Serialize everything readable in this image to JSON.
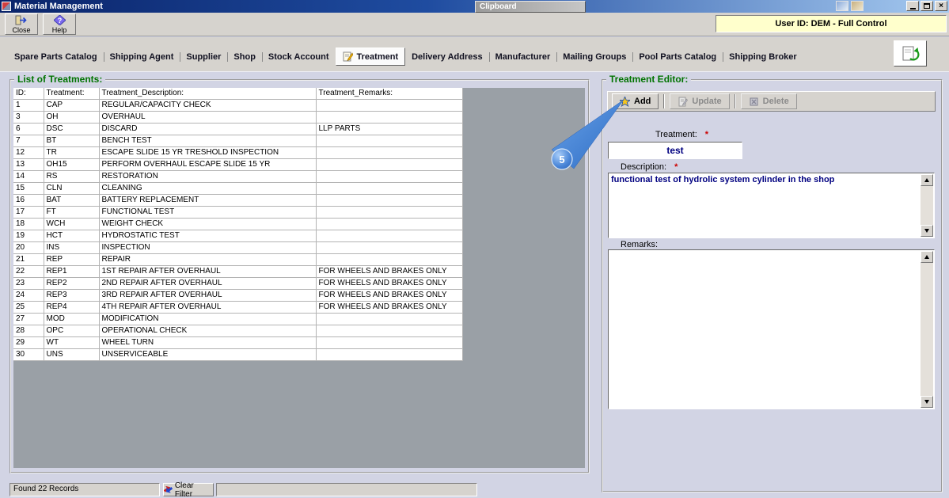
{
  "window": {
    "title": "Material Management",
    "clipboard_label": "Clipboard",
    "user_id": "User ID: DEM - Full Control",
    "controls": {
      "close_glyph": "×"
    }
  },
  "toolbar": {
    "close_label": "Close",
    "help_label": "Help"
  },
  "tabs": [
    {
      "label": "Spare Parts Catalog",
      "active": false
    },
    {
      "label": "Shipping Agent",
      "active": false
    },
    {
      "label": "Supplier",
      "active": false
    },
    {
      "label": "Shop",
      "active": false
    },
    {
      "label": "Stock Account",
      "active": false
    },
    {
      "label": "Treatment",
      "active": true
    },
    {
      "label": "Delivery Address",
      "active": false
    },
    {
      "label": "Manufacturer",
      "active": false
    },
    {
      "label": "Mailing Groups",
      "active": false
    },
    {
      "label": "Pool Parts Catalog",
      "active": false
    },
    {
      "label": "Shipping Broker",
      "active": false
    }
  ],
  "treatments": {
    "section_title": "List of Treatments:",
    "columns": [
      "ID:",
      "Treatment:",
      "Treatment_Description:",
      "Treatment_Remarks:"
    ],
    "rows": [
      [
        "1",
        "CAP",
        "REGULAR/CAPACITY CHECK",
        ""
      ],
      [
        "3",
        "OH",
        "OVERHAUL",
        ""
      ],
      [
        "6",
        "DSC",
        "DISCARD",
        "LLP PARTS"
      ],
      [
        "7",
        "BT",
        "BENCH TEST",
        ""
      ],
      [
        "12",
        "TR",
        "ESCAPE SLIDE 15 YR TRESHOLD INSPECTION",
        ""
      ],
      [
        "13",
        "OH15",
        "PERFORM OVERHAUL ESCAPE SLIDE 15 YR",
        ""
      ],
      [
        "14",
        "RS",
        "RESTORATION",
        ""
      ],
      [
        "15",
        "CLN",
        "CLEANING",
        ""
      ],
      [
        "16",
        "BAT",
        "BATTERY REPLACEMENT",
        ""
      ],
      [
        "17",
        "FT",
        "FUNCTIONAL TEST",
        ""
      ],
      [
        "18",
        "WCH",
        "WEIGHT CHECK",
        ""
      ],
      [
        "19",
        "HCT",
        "HYDROSTATIC TEST",
        ""
      ],
      [
        "20",
        "INS",
        "INSPECTION",
        ""
      ],
      [
        "21",
        "REP",
        "REPAIR",
        ""
      ],
      [
        "22",
        "REP1",
        "1ST REPAIR AFTER OVERHAUL",
        "FOR WHEELS AND BRAKES ONLY"
      ],
      [
        "23",
        "REP2",
        "2ND REPAIR AFTER OVERHAUL",
        "FOR WHEELS AND BRAKES ONLY"
      ],
      [
        "24",
        "REP3",
        "3RD REPAIR AFTER OVERHAUL",
        "FOR WHEELS AND BRAKES ONLY"
      ],
      [
        "25",
        "REP4",
        "4TH REPAIR AFTER OVERHAUL",
        "FOR WHEELS AND BRAKES ONLY"
      ],
      [
        "27",
        "MOD",
        "MODIFICATION",
        ""
      ],
      [
        "28",
        "OPC",
        "OPERATIONAL CHECK",
        ""
      ],
      [
        "29",
        "WT",
        "WHEEL TURN",
        ""
      ],
      [
        "30",
        "UNS",
        "UNSERVICEABLE",
        ""
      ]
    ],
    "status_text": "Found 22 Records",
    "clear_filter_label": "Clear Filter"
  },
  "editor": {
    "section_title": "Treatment Editor:",
    "buttons": {
      "add": "Add",
      "update": "Update",
      "delete": "Delete"
    },
    "treatment_label": "Treatment:",
    "treatment_value": "test",
    "description_label": "Description:",
    "description_value": "functional test of hydrolic system cylinder in the shop",
    "remarks_label": "Remarks:",
    "remarks_value": "",
    "required_marker": "*"
  },
  "callout": {
    "number": "5"
  },
  "icons": {
    "add_icon": "yellow-starburst",
    "update_icon": "sheet-pencil",
    "delete_icon": "gray-box",
    "clear_filter_icon": "red-blue-arrows",
    "close_icon": "exit-door-arrow",
    "help_icon": "question-diamond",
    "export_icon": "sheet-green-arrow",
    "treatment_tab_icon": "note-pencil"
  },
  "colors": {
    "title_green": "#007300",
    "value_navy": "#000080",
    "callout_blue": "#3a7bd5",
    "user_panel_yellow": "#ffffcc"
  }
}
